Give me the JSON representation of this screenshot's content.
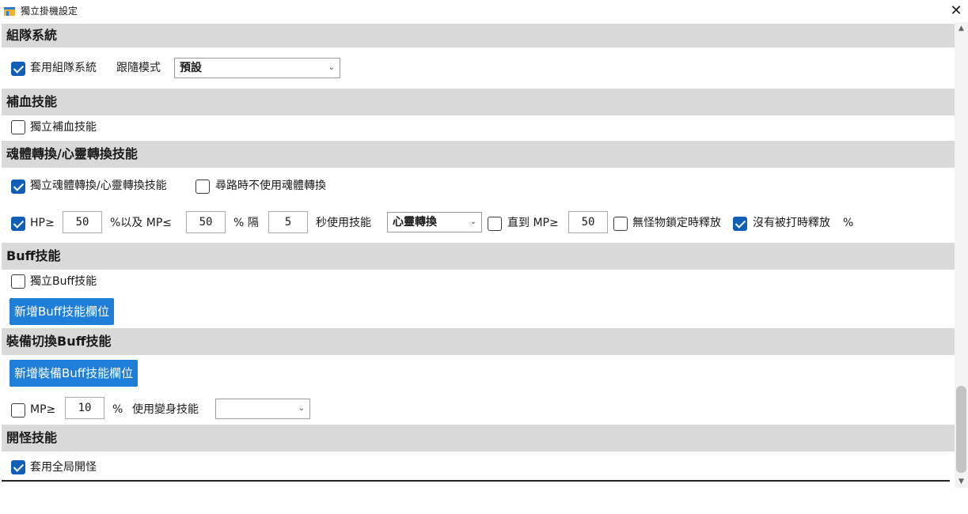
{
  "window": {
    "title": "獨立掛機設定",
    "close_icon": "close-icon"
  },
  "party": {
    "header": "組隊系統",
    "use_party_label": "套用組隊系統",
    "use_party_checked": true,
    "follow_mode_label": "跟隨模式",
    "follow_mode_value": "預設"
  },
  "heal": {
    "header": "補血技能",
    "independent_label": "獨立補血技能",
    "independent_checked": false
  },
  "soul": {
    "header": "魂體轉換/心靈轉換技能",
    "independent_label": "獨立魂體轉換/心靈轉換技能",
    "independent_checked": true,
    "no_pathfind_label": "尋路時不使用魂體轉換",
    "no_pathfind_checked": false,
    "hp_checked": true,
    "hp_label": "HP≥",
    "hp_value": "50",
    "mp_label": "%以及 MP≤",
    "mp_value": "50",
    "interval_label": "% 隔",
    "interval_value": "5",
    "use_skill_label": "秒使用技能",
    "skill_value": "心靈轉換",
    "until_checked": false,
    "until_label": "直到 MP≥",
    "until_value": "50",
    "no_lock_checked": false,
    "no_lock_label": "無怪物鎖定時釋放",
    "not_hit_checked": true,
    "not_hit_label": "沒有被打時釋放",
    "pct_label": "%"
  },
  "buff": {
    "header": "Buff技能",
    "independent_label": "獨立Buff技能",
    "independent_checked": false,
    "add_button": "新增Buff技能欄位"
  },
  "equip_buff": {
    "header": "裝備切換Buff技能",
    "add_button": "新增裝備Buff技能欄位",
    "mp_checked": false,
    "mp_label": "MP≥",
    "mp_value": "10",
    "pct_label": "%",
    "transform_label": "使用變身技能",
    "transform_value": ""
  },
  "opening": {
    "header": "開怪技能",
    "global_label": "套用全局開怪",
    "global_checked": true
  },
  "colors": {
    "accent": "#1f7fd8",
    "header_bg": "#d9d9d9",
    "check": "#0f5fb8"
  }
}
